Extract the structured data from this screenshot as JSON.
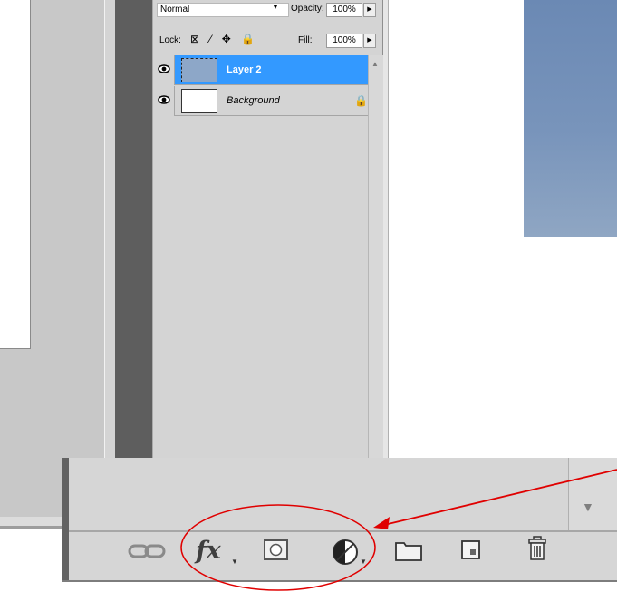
{
  "layers_panel": {
    "blend_mode": "Normal",
    "opacity_label": "Opacity:",
    "opacity_value": "100%",
    "lock_label": "Lock:",
    "lock_icons": "⊠ ⁄ ✥ 🔒",
    "fill_label": "Fill:",
    "fill_value": "100%",
    "layers": [
      {
        "name": "Layer 2",
        "visible": true,
        "selected": true
      },
      {
        "name": "Background",
        "visible": true,
        "selected": false,
        "locked": true
      }
    ]
  },
  "toolbar": {
    "fx_label": "fx",
    "tools": [
      "link-layers-icon",
      "layer-style-fx-icon",
      "add-mask-icon",
      "adjustment-layer-icon",
      "new-group-icon",
      "new-layer-icon",
      "delete-layer-icon"
    ]
  },
  "colors": {
    "selection": "#3399ff",
    "panel_bg": "#d4d4d4",
    "annotation": "#e00000"
  }
}
